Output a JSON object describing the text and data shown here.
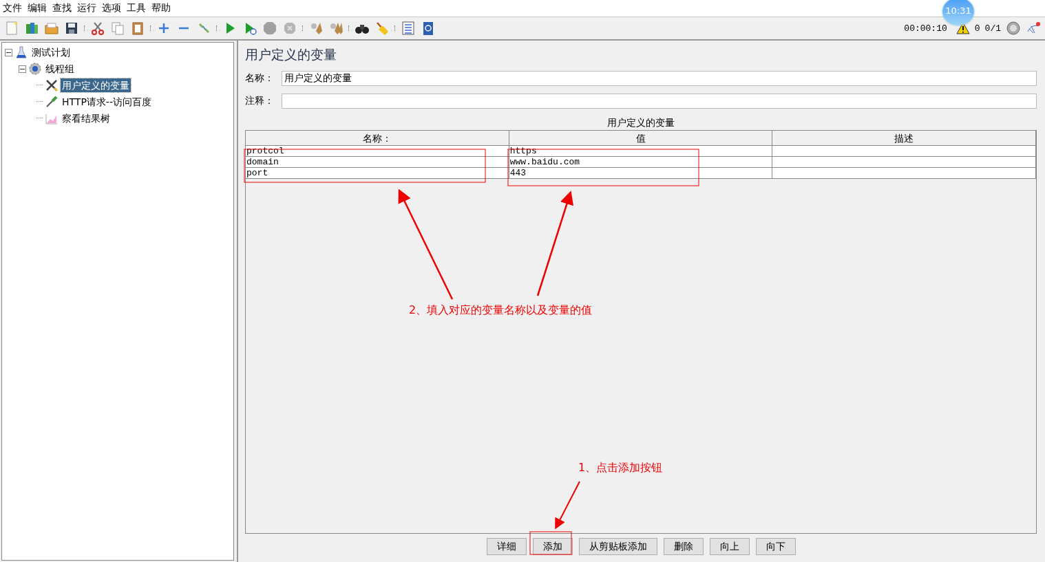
{
  "menu": [
    "文件",
    "编辑",
    "查找",
    "运行",
    "选项",
    "工具",
    "帮助"
  ],
  "status": {
    "timer": "00:00:10",
    "warnings": "0",
    "threads": "0/1"
  },
  "clock_overlay": "10:31",
  "tree": [
    {
      "label": "测试计划",
      "kind": "plan",
      "expanded": true,
      "selected": false,
      "children": [
        {
          "label": "线程组",
          "kind": "thread-group",
          "expanded": true,
          "selected": false,
          "children": [
            {
              "label": "用户定义的变量",
              "kind": "config",
              "selected": true
            },
            {
              "label": "HTTP请求--访问百度",
              "kind": "sampler",
              "selected": false
            },
            {
              "label": "察看结果树",
              "kind": "listener",
              "selected": false
            }
          ]
        }
      ]
    }
  ],
  "panel": {
    "title": "用户定义的变量",
    "name_label": "名称：",
    "name_value": "用户定义的变量",
    "comment_label": "注释："
  },
  "table": {
    "caption": "用户定义的变量",
    "columns": [
      "名称：",
      "值",
      "描述"
    ],
    "rows": [
      [
        "protcol",
        "https",
        ""
      ],
      [
        "domain",
        "www.baidu.com",
        ""
      ],
      [
        "port",
        "443",
        ""
      ]
    ]
  },
  "buttons": [
    "详细",
    "添加",
    "从剪贴板添加",
    "删除",
    "向上",
    "向下"
  ],
  "annotations": [
    {
      "text": "2、填入对应的变量名称以及变量的值"
    },
    {
      "text": "1、点击添加按钮"
    }
  ]
}
